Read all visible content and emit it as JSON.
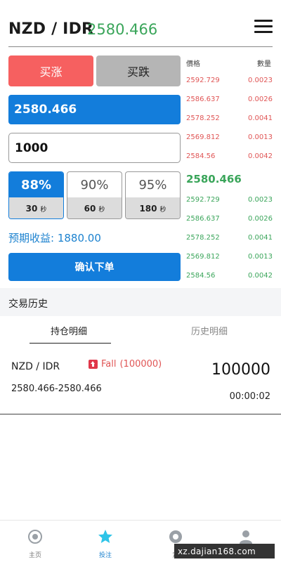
{
  "header": {
    "pair": "NZD / IDR",
    "price": "2580.466"
  },
  "trade": {
    "buy_up_label": "买涨",
    "buy_down_label": "买跌",
    "current_price": "2580.466",
    "amount_value": "1000",
    "options": [
      {
        "percent": "88%",
        "seconds": "30",
        "unit": "秒",
        "active": true
      },
      {
        "percent": "90%",
        "seconds": "60",
        "unit": "秒",
        "active": false
      },
      {
        "percent": "95%",
        "seconds": "180",
        "unit": "秒",
        "active": false
      }
    ],
    "expected_label": "预期收益:",
    "expected_value": "1880.00",
    "confirm_label": "确认下单"
  },
  "orderbook": {
    "price_header": "價格",
    "qty_header": "數量",
    "asks": [
      {
        "price": "2592.729",
        "qty": "0.0023"
      },
      {
        "price": "2586.637",
        "qty": "0.0026"
      },
      {
        "price": "2578.252",
        "qty": "0.0041"
      },
      {
        "price": "2569.812",
        "qty": "0.0013"
      },
      {
        "price": "2584.56",
        "qty": "0.0042"
      }
    ],
    "mid_price": "2580.466",
    "bids": [
      {
        "price": "2592.729",
        "qty": "0.0023"
      },
      {
        "price": "2586.637",
        "qty": "0.0026"
      },
      {
        "price": "2578.252",
        "qty": "0.0041"
      },
      {
        "price": "2569.812",
        "qty": "0.0013"
      },
      {
        "price": "2584.56",
        "qty": "0.0042"
      }
    ]
  },
  "history": {
    "section_title": "交易历史",
    "tab_open": "持仓明细",
    "tab_history": "历史明细",
    "position": {
      "pair": "NZD / IDR",
      "direction": "Fall",
      "direction_amount": "(100000)",
      "amount": "100000",
      "price_range": "2580.466-2580.466",
      "timer": "00:00:02"
    }
  },
  "nav": {
    "items": [
      {
        "label": "主页",
        "icon": "home-icon"
      },
      {
        "label": "投注",
        "icon": "star-icon"
      },
      {
        "label": "定",
        "icon": "order-icon"
      },
      {
        "label": "",
        "icon": "user-icon"
      }
    ]
  },
  "watermark": {
    "site": "xz.dajian168.com"
  },
  "colors": {
    "accent": "#137ddb",
    "up": "#f66060",
    "green": "#3aa55a",
    "red": "#e05555"
  }
}
